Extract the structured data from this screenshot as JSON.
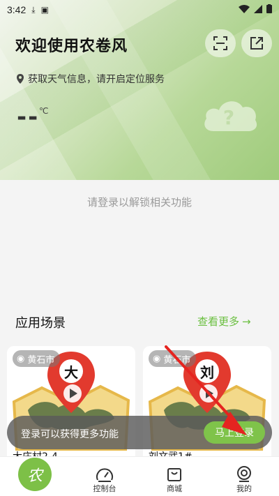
{
  "status_bar": {
    "time": "3:42"
  },
  "header": {
    "welcome": "欢迎使用农卷风"
  },
  "weather": {
    "location_hint": "获取天气信息，请开启定位服务",
    "temp": "--",
    "unit": "℃"
  },
  "login_hint": "请登录以解锁相关功能",
  "scenes": {
    "title": "应用场景",
    "more": "查看更多",
    "items": [
      {
        "city": "黄石市",
        "avatar_char": "大",
        "name": "大庄村2-4"
      },
      {
        "city": "黄石市",
        "avatar_char": "刘",
        "name": "刘文武1#"
      }
    ]
  },
  "toast": {
    "text": "登录可以获得更多功能",
    "button": "马上登录"
  },
  "tabbar": {
    "home_char": "农",
    "items": [
      {
        "label": "控制台",
        "icon": "dashboard-icon"
      },
      {
        "label": "商城",
        "icon": "shop-bag-icon"
      },
      {
        "label": "我的",
        "icon": "robot-profile-icon"
      }
    ]
  },
  "colors": {
    "accent": "#7fc34a",
    "marker_red": "#e23a2e"
  }
}
